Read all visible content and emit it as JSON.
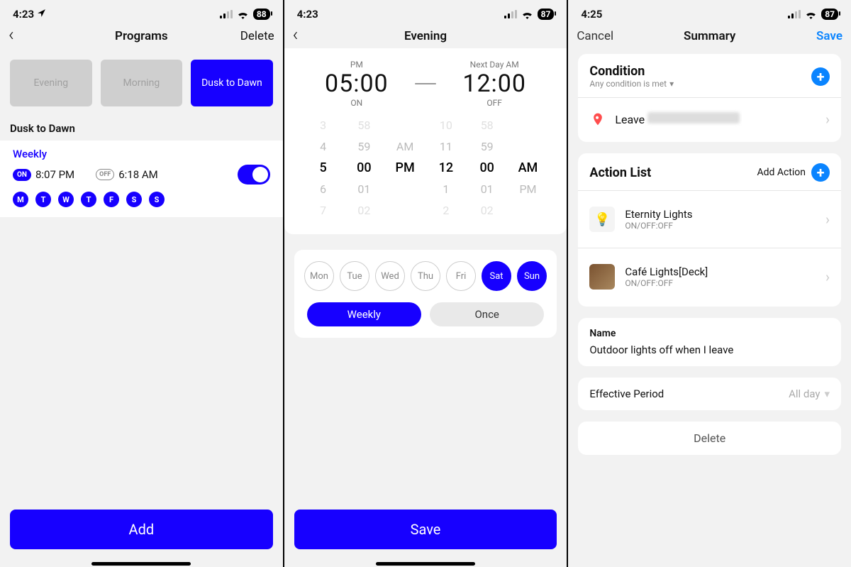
{
  "colors": {
    "brand_blue": "#1700ff",
    "system_blue": "#0a84ff"
  },
  "screen1": {
    "status": {
      "time": "4:23",
      "battery": "88"
    },
    "nav": {
      "title": "Programs",
      "right": "Delete"
    },
    "tabs": {
      "evening": "Evening",
      "morning": "Morning",
      "dusk": "Dusk to Dawn"
    },
    "section_label": "Dusk to Dawn",
    "program": {
      "title": "Weekly",
      "on_badge": "ON",
      "on_time": "8:07 PM",
      "off_badge": "OFF",
      "off_time": "6:18 AM",
      "days": [
        "M",
        "T",
        "W",
        "T",
        "F",
        "S",
        "S"
      ]
    },
    "add_button": "Add"
  },
  "screen2": {
    "status": {
      "time": "4:23",
      "battery": "87"
    },
    "nav": {
      "title": "Evening"
    },
    "time": {
      "on_meridiem_label": "PM",
      "on_value": "05:00",
      "on_sub": "ON",
      "off_meridiem_label": "Next Day AM",
      "off_value": "12:00",
      "off_sub": "OFF"
    },
    "wheel_on": {
      "h": [
        "3",
        "4",
        "5",
        "6",
        "7"
      ],
      "m": [
        "58",
        "59",
        "00",
        "01",
        "02"
      ],
      "a": [
        "",
        "AM",
        "PM",
        "",
        ""
      ]
    },
    "wheel_off": {
      "h": [
        "10",
        "11",
        "12",
        "1",
        "2"
      ],
      "m": [
        "58",
        "59",
        "00",
        "01",
        "02"
      ],
      "a": [
        "",
        "",
        "AM",
        "PM",
        ""
      ]
    },
    "day_circles": [
      {
        "label": "Mon",
        "on": false
      },
      {
        "label": "Tue",
        "on": false
      },
      {
        "label": "Wed",
        "on": false
      },
      {
        "label": "Thu",
        "on": false
      },
      {
        "label": "Fri",
        "on": false
      },
      {
        "label": "Sat",
        "on": true
      },
      {
        "label": "Sun",
        "on": true
      }
    ],
    "seg": {
      "weekly": "Weekly",
      "once": "Once"
    },
    "save_button": "Save"
  },
  "screen3": {
    "status": {
      "time": "4:25",
      "battery": "87"
    },
    "nav": {
      "title": "Summary",
      "left": "Cancel",
      "right": "Save"
    },
    "condition": {
      "title": "Condition",
      "subtitle": "Any condition is met",
      "item_prefix": "Leave"
    },
    "actions": {
      "title": "Action List",
      "add_label": "Add Action",
      "items": [
        {
          "name": "Eternity Lights",
          "sub": "ON/OFF:OFF",
          "icon": "light-string"
        },
        {
          "name": "Café Lights[Deck]",
          "sub": "ON/OFF:OFF",
          "icon": "product-photo"
        }
      ]
    },
    "name_section": {
      "label": "Name",
      "value": "Outdoor lights off when I leave"
    },
    "effective": {
      "label": "Effective Period",
      "value": "All day"
    },
    "delete": "Delete"
  }
}
